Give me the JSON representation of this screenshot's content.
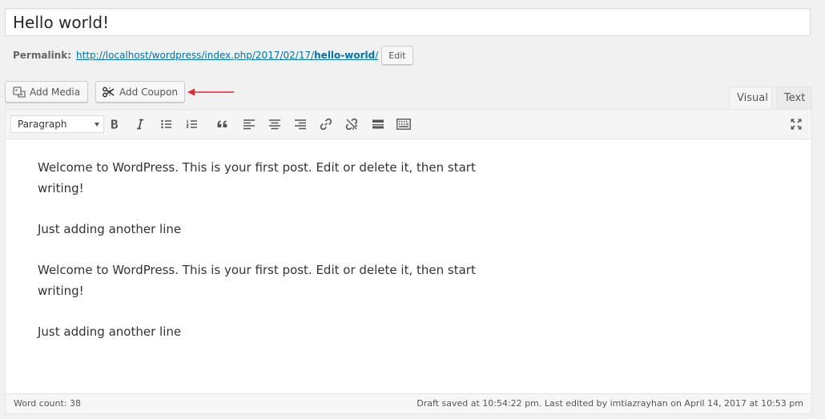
{
  "post": {
    "title": "Hello world!",
    "permalink_label": "Permalink:",
    "permalink_base": "http://localhost/wordpress/index.php/2017/02/17/",
    "permalink_slug": "hello-world",
    "permalink_tail": "/",
    "edit_label": "Edit"
  },
  "media_buttons": {
    "add_media": "Add Media",
    "add_coupon": "Add Coupon"
  },
  "editor_tabs": {
    "visual": "Visual",
    "text": "Text"
  },
  "toolbar": {
    "format_selected": "Paragraph"
  },
  "content": {
    "paragraphs": [
      "Welcome to WordPress. This is your first post. Edit or delete it, then start writing!",
      "Just adding another line",
      "Welcome to WordPress. This is your first post. Edit or delete it, then start writing!",
      "Just adding another line"
    ]
  },
  "status": {
    "word_count": "Word count: 38",
    "draft_info": "Draft saved at 10:54:22 pm. Last edited by imtiazrayhan on April 14, 2017 at 10:53 pm"
  },
  "colors": {
    "link": "#0073aa",
    "annotation_arrow": "#e0282d"
  }
}
